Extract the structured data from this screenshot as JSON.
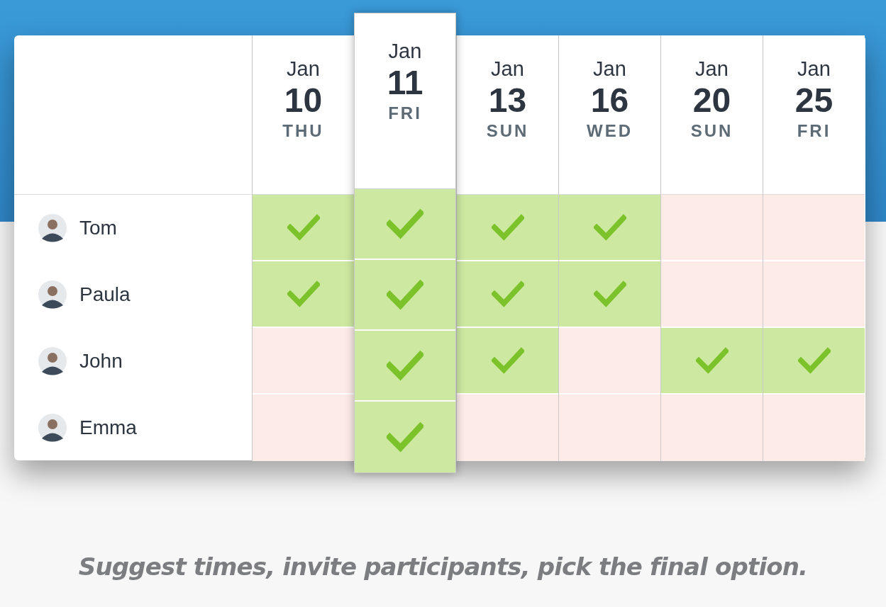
{
  "dates": [
    {
      "month": "Jan",
      "day": "10",
      "weekday": "THU",
      "selected": false
    },
    {
      "month": "Jan",
      "day": "11",
      "weekday": "FRI",
      "selected": true
    },
    {
      "month": "Jan",
      "day": "13",
      "weekday": "SUN",
      "selected": false
    },
    {
      "month": "Jan",
      "day": "16",
      "weekday": "WED",
      "selected": false
    },
    {
      "month": "Jan",
      "day": "20",
      "weekday": "SUN",
      "selected": false
    },
    {
      "month": "Jan",
      "day": "25",
      "weekday": "FRI",
      "selected": false
    }
  ],
  "people": [
    {
      "name": "Tom",
      "available": [
        true,
        true,
        true,
        true,
        false,
        false
      ]
    },
    {
      "name": "Paula",
      "available": [
        true,
        true,
        true,
        true,
        false,
        false
      ]
    },
    {
      "name": "John",
      "available": [
        false,
        true,
        true,
        false,
        true,
        true
      ]
    },
    {
      "name": "Emma",
      "available": [
        false,
        true,
        false,
        false,
        false,
        false
      ]
    }
  ],
  "caption": "Suggest times, invite participants, pick the final option."
}
